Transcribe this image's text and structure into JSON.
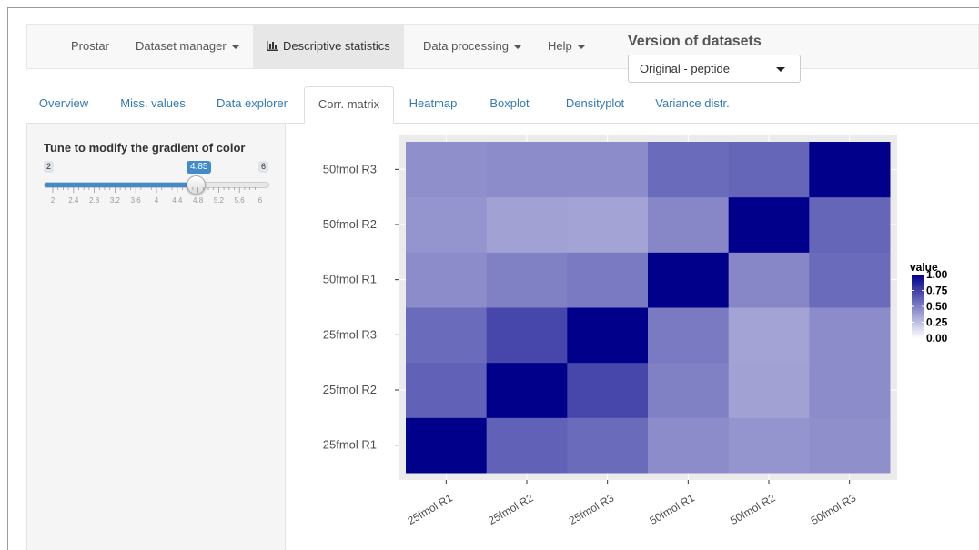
{
  "navbar": {
    "items": [
      {
        "label": "Prostar",
        "dropdown": false,
        "active": false
      },
      {
        "label": "Dataset manager",
        "dropdown": true,
        "active": false
      },
      {
        "label": "Descriptive statistics",
        "dropdown": false,
        "active": true,
        "icon": "bar-chart-icon"
      },
      {
        "label": "Data processing",
        "dropdown": true,
        "active": false
      },
      {
        "label": "Help",
        "dropdown": true,
        "active": false
      }
    ],
    "version_title": "Version of datasets",
    "version_select": "Original - peptide"
  },
  "tabs": [
    {
      "label": "Overview"
    },
    {
      "label": "Miss. values"
    },
    {
      "label": "Data explorer"
    },
    {
      "label": "Corr. matrix",
      "active": true
    },
    {
      "label": "Heatmap"
    },
    {
      "label": "Boxplot"
    },
    {
      "label": "Densityplot"
    },
    {
      "label": "Variance distr."
    }
  ],
  "sidebar": {
    "slider": {
      "label": "Tune to modify the gradient of color",
      "min_label": "2",
      "max_label": "6",
      "value_label": "4.85",
      "value": 4.85,
      "min": 2,
      "max": 6,
      "grid_labels": [
        "2",
        "2.4",
        "2.8",
        "3.2",
        "3.6",
        "4",
        "4.4",
        "4.8",
        "5.2",
        "5.6",
        "6"
      ]
    }
  },
  "chart_data": {
    "type": "heatmap",
    "x_categories": [
      "25fmol R1",
      "25fmol R2",
      "25fmol R3",
      "50fmol R1",
      "50fmol R2",
      "50fmol R3"
    ],
    "y_categories": [
      "25fmol R1",
      "25fmol R2",
      "25fmol R3",
      "50fmol R1",
      "50fmol R2",
      "50fmol R3"
    ],
    "values": [
      [
        1.0,
        0.62,
        0.58,
        0.45,
        0.42,
        0.44
      ],
      [
        0.62,
        1.0,
        0.72,
        0.5,
        0.37,
        0.45
      ],
      [
        0.58,
        0.72,
        1.0,
        0.52,
        0.36,
        0.45
      ],
      [
        0.45,
        0.5,
        0.52,
        1.0,
        0.47,
        0.58
      ],
      [
        0.42,
        0.37,
        0.36,
        0.47,
        1.0,
        0.6
      ],
      [
        0.44,
        0.45,
        0.45,
        0.58,
        0.6,
        1.0
      ]
    ],
    "legend_title": "value",
    "legend_ticks": [
      "1.00",
      "0.75",
      "0.50",
      "0.25",
      "0.00"
    ],
    "color_low": "#ffffff",
    "color_high": "#00008b",
    "panel_background": "#ebebeb",
    "grid": true
  }
}
